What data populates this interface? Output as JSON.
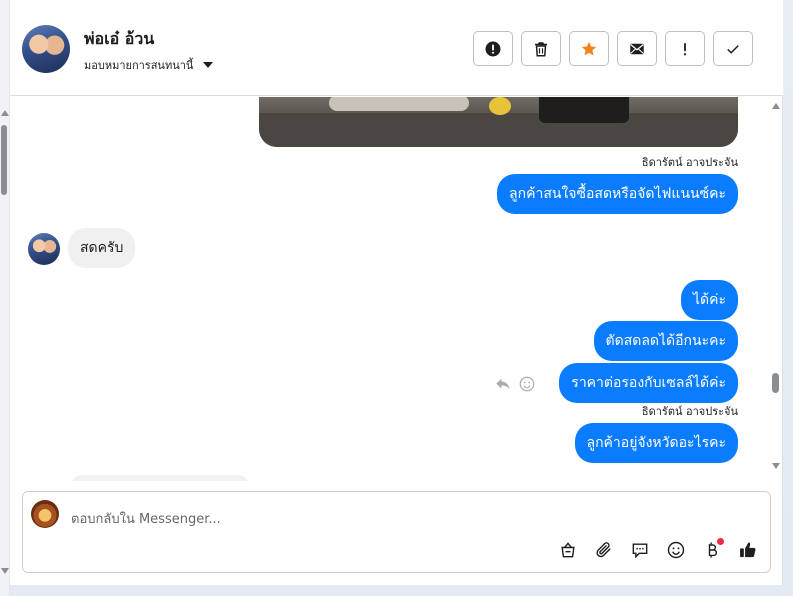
{
  "header": {
    "contact_name": "พ่อเอ๋ อ้วน",
    "assign_label": "มอบหมายการสนทนานี้"
  },
  "actions": [
    {
      "name": "spam-button",
      "icon": "alert-circle-icon"
    },
    {
      "name": "delete-button",
      "icon": "trash-icon"
    },
    {
      "name": "star-button",
      "icon": "star-icon",
      "color": "#f0861b"
    },
    {
      "name": "mark-unread-button",
      "icon": "envelope-icon"
    },
    {
      "name": "follow-up-button",
      "icon": "exclamation-icon"
    },
    {
      "name": "done-button",
      "icon": "check-icon"
    }
  ],
  "messages": {
    "sender1": "ธิดารัตน์ อาจประจัน",
    "out1": "ลูกค้าสนใจซื้อสดหรือจัดไฟแนนซ์คะ",
    "in1": "สดครับ",
    "out2": "ได้ค่ะ",
    "out3": "ตัดสดลดได้อีกนะคะ",
    "out4": "ราคาต่อรองกับเซลล์ได้ค่ะ",
    "sender2": "ธิดารัตน์ อาจประจัน",
    "out5": "ลูกค้าอยู่จังหวัดอะไรคะ"
  },
  "composer": {
    "placeholder": "ตอบกลับใน Messenger..."
  },
  "colors": {
    "accent": "#0a7cff",
    "notification_dot": "#f02849"
  }
}
